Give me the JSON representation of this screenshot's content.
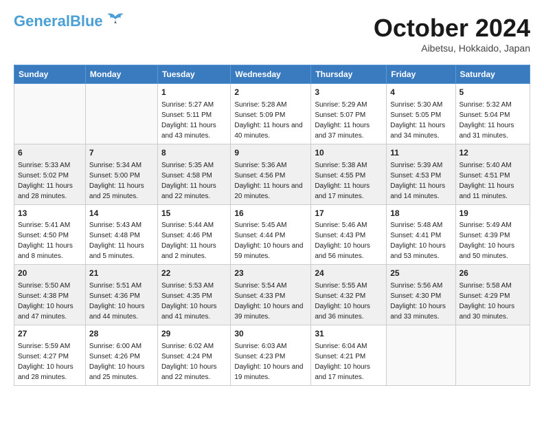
{
  "logo": {
    "line1": "General",
    "line2": "Blue"
  },
  "title": "October 2024",
  "location": "Aibetsu, Hokkaido, Japan",
  "weekdays": [
    "Sunday",
    "Monday",
    "Tuesday",
    "Wednesday",
    "Thursday",
    "Friday",
    "Saturday"
  ],
  "weeks": [
    [
      {
        "day": "",
        "content": ""
      },
      {
        "day": "",
        "content": ""
      },
      {
        "day": "1",
        "content": "Sunrise: 5:27 AM\nSunset: 5:11 PM\nDaylight: 11 hours and 43 minutes."
      },
      {
        "day": "2",
        "content": "Sunrise: 5:28 AM\nSunset: 5:09 PM\nDaylight: 11 hours and 40 minutes."
      },
      {
        "day": "3",
        "content": "Sunrise: 5:29 AM\nSunset: 5:07 PM\nDaylight: 11 hours and 37 minutes."
      },
      {
        "day": "4",
        "content": "Sunrise: 5:30 AM\nSunset: 5:05 PM\nDaylight: 11 hours and 34 minutes."
      },
      {
        "day": "5",
        "content": "Sunrise: 5:32 AM\nSunset: 5:04 PM\nDaylight: 11 hours and 31 minutes."
      }
    ],
    [
      {
        "day": "6",
        "content": "Sunrise: 5:33 AM\nSunset: 5:02 PM\nDaylight: 11 hours and 28 minutes."
      },
      {
        "day": "7",
        "content": "Sunrise: 5:34 AM\nSunset: 5:00 PM\nDaylight: 11 hours and 25 minutes."
      },
      {
        "day": "8",
        "content": "Sunrise: 5:35 AM\nSunset: 4:58 PM\nDaylight: 11 hours and 22 minutes."
      },
      {
        "day": "9",
        "content": "Sunrise: 5:36 AM\nSunset: 4:56 PM\nDaylight: 11 hours and 20 minutes."
      },
      {
        "day": "10",
        "content": "Sunrise: 5:38 AM\nSunset: 4:55 PM\nDaylight: 11 hours and 17 minutes."
      },
      {
        "day": "11",
        "content": "Sunrise: 5:39 AM\nSunset: 4:53 PM\nDaylight: 11 hours and 14 minutes."
      },
      {
        "day": "12",
        "content": "Sunrise: 5:40 AM\nSunset: 4:51 PM\nDaylight: 11 hours and 11 minutes."
      }
    ],
    [
      {
        "day": "13",
        "content": "Sunrise: 5:41 AM\nSunset: 4:50 PM\nDaylight: 11 hours and 8 minutes."
      },
      {
        "day": "14",
        "content": "Sunrise: 5:43 AM\nSunset: 4:48 PM\nDaylight: 11 hours and 5 minutes."
      },
      {
        "day": "15",
        "content": "Sunrise: 5:44 AM\nSunset: 4:46 PM\nDaylight: 11 hours and 2 minutes."
      },
      {
        "day": "16",
        "content": "Sunrise: 5:45 AM\nSunset: 4:44 PM\nDaylight: 10 hours and 59 minutes."
      },
      {
        "day": "17",
        "content": "Sunrise: 5:46 AM\nSunset: 4:43 PM\nDaylight: 10 hours and 56 minutes."
      },
      {
        "day": "18",
        "content": "Sunrise: 5:48 AM\nSunset: 4:41 PM\nDaylight: 10 hours and 53 minutes."
      },
      {
        "day": "19",
        "content": "Sunrise: 5:49 AM\nSunset: 4:39 PM\nDaylight: 10 hours and 50 minutes."
      }
    ],
    [
      {
        "day": "20",
        "content": "Sunrise: 5:50 AM\nSunset: 4:38 PM\nDaylight: 10 hours and 47 minutes."
      },
      {
        "day": "21",
        "content": "Sunrise: 5:51 AM\nSunset: 4:36 PM\nDaylight: 10 hours and 44 minutes."
      },
      {
        "day": "22",
        "content": "Sunrise: 5:53 AM\nSunset: 4:35 PM\nDaylight: 10 hours and 41 minutes."
      },
      {
        "day": "23",
        "content": "Sunrise: 5:54 AM\nSunset: 4:33 PM\nDaylight: 10 hours and 39 minutes."
      },
      {
        "day": "24",
        "content": "Sunrise: 5:55 AM\nSunset: 4:32 PM\nDaylight: 10 hours and 36 minutes."
      },
      {
        "day": "25",
        "content": "Sunrise: 5:56 AM\nSunset: 4:30 PM\nDaylight: 10 hours and 33 minutes."
      },
      {
        "day": "26",
        "content": "Sunrise: 5:58 AM\nSunset: 4:29 PM\nDaylight: 10 hours and 30 minutes."
      }
    ],
    [
      {
        "day": "27",
        "content": "Sunrise: 5:59 AM\nSunset: 4:27 PM\nDaylight: 10 hours and 28 minutes."
      },
      {
        "day": "28",
        "content": "Sunrise: 6:00 AM\nSunset: 4:26 PM\nDaylight: 10 hours and 25 minutes."
      },
      {
        "day": "29",
        "content": "Sunrise: 6:02 AM\nSunset: 4:24 PM\nDaylight: 10 hours and 22 minutes."
      },
      {
        "day": "30",
        "content": "Sunrise: 6:03 AM\nSunset: 4:23 PM\nDaylight: 10 hours and 19 minutes."
      },
      {
        "day": "31",
        "content": "Sunrise: 6:04 AM\nSunset: 4:21 PM\nDaylight: 10 hours and 17 minutes."
      },
      {
        "day": "",
        "content": ""
      },
      {
        "day": "",
        "content": ""
      }
    ]
  ]
}
